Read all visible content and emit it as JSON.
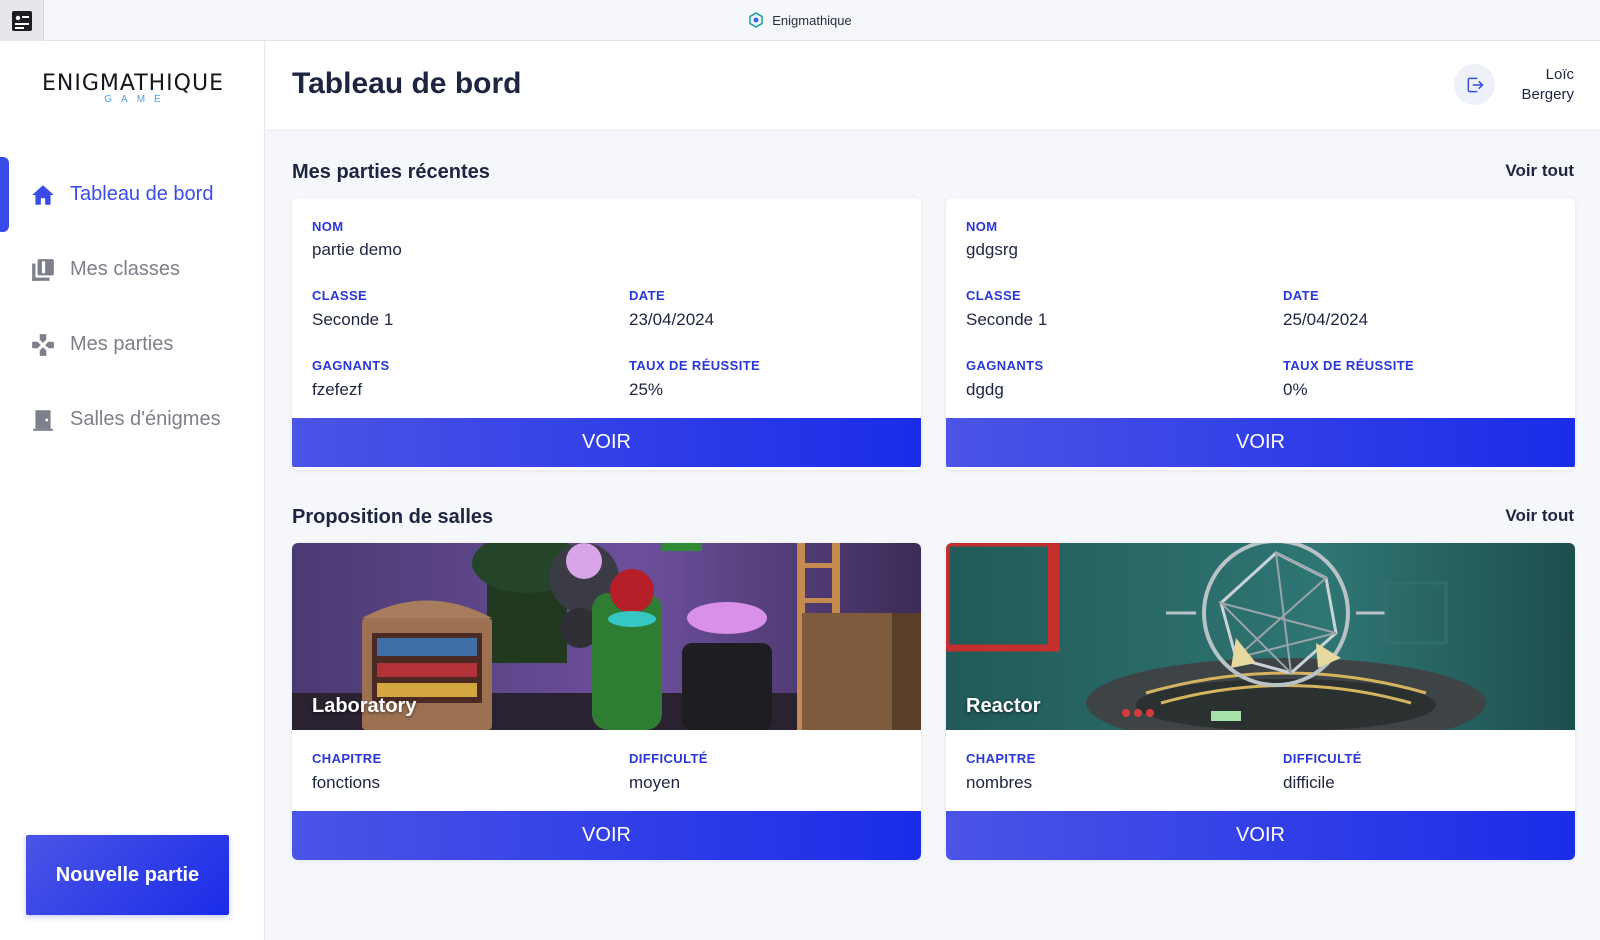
{
  "browser": {
    "tab_title": "Enigmathique"
  },
  "logo": {
    "main": "ENIGMATHIQUE",
    "sub": "GAME"
  },
  "sidebar": {
    "items": [
      {
        "label": "Tableau de bord",
        "icon": "home-icon",
        "active": true
      },
      {
        "label": "Mes classes",
        "icon": "books-icon",
        "active": false
      },
      {
        "label": "Mes parties",
        "icon": "gamepad-icon",
        "active": false
      },
      {
        "label": "Salles d'énigmes",
        "icon": "door-icon",
        "active": false
      }
    ],
    "new_game_label": "Nouvelle partie"
  },
  "header": {
    "title": "Tableau de bord",
    "user_first": "Loïc",
    "user_last": "Bergery"
  },
  "recent": {
    "title": "Mes parties récentes",
    "see_all": "Voir tout",
    "labels": {
      "name": "NOM",
      "class": "CLASSE",
      "date": "DATE",
      "winners": "GAGNANTS",
      "rate": "TAUX DE RÉUSSITE"
    },
    "games": [
      {
        "name": "partie demo",
        "class": "Seconde 1",
        "date": "23/04/2024",
        "winners": "fzefezf",
        "rate": "25%",
        "button": "VOIR"
      },
      {
        "name": "gdgsrg",
        "class": "Seconde 1",
        "date": "25/04/2024",
        "winners": "dgdg",
        "rate": "0%",
        "button": "VOIR"
      }
    ]
  },
  "rooms": {
    "title": "Proposition de salles",
    "see_all": "Voir tout",
    "labels": {
      "chapter": "CHAPITRE",
      "difficulty": "DIFFICULTÉ"
    },
    "items": [
      {
        "name": "Laboratory",
        "chapter": "fonctions",
        "difficulty": "moyen",
        "button": "VOIR"
      },
      {
        "name": "Reactor",
        "chapter": "nombres",
        "difficulty": "difficile",
        "button": "VOIR"
      }
    ]
  },
  "colors": {
    "accent": "#3a4ce8",
    "button": "#1a2ce8",
    "label": "#2a37d8"
  }
}
